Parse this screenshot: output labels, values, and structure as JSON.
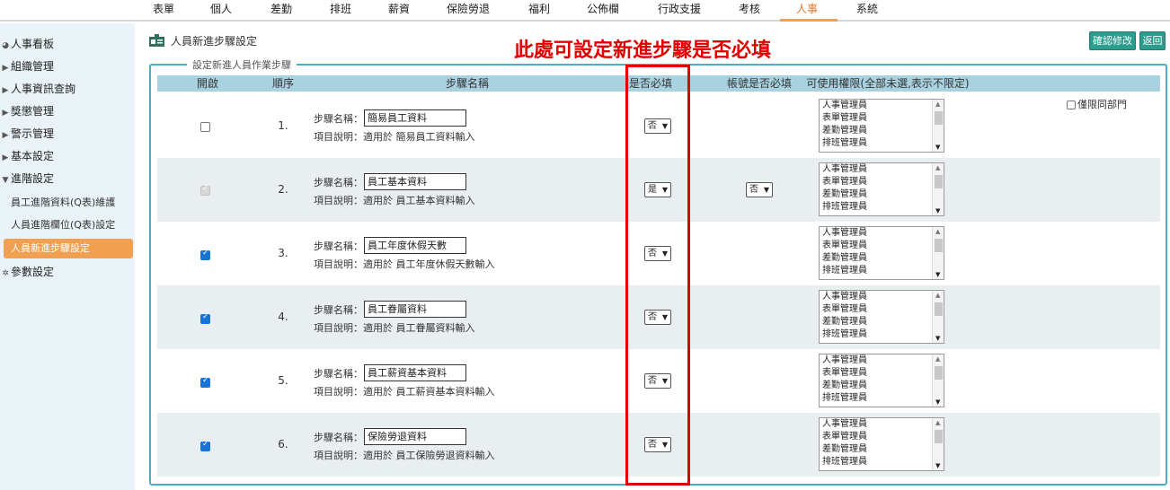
{
  "nav": {
    "items": [
      "表單",
      "個人",
      "差勤",
      "排班",
      "薪資",
      "保險勞退",
      "福利",
      "公佈欄",
      "行政支援",
      "考核",
      "人事",
      "系統"
    ],
    "active": "人事",
    "accent_color": "#f0a050"
  },
  "sidebar": {
    "items": [
      "人事看板",
      "組織管理",
      "人事資訊查詢",
      "獎懲管理",
      "警示管理",
      "基本設定",
      "進階設定",
      "參數設定"
    ],
    "sub_items": [
      "員工進階資料(Q表)維護",
      "人員進階欄位(Q表)設定",
      "人員新進步驟設定"
    ],
    "active_sub": "人員新進步驟設定"
  },
  "page": {
    "title": "人員新進步驟設定",
    "confirm_label": "確認修改",
    "back_label": "返回",
    "annotation": "此處可設定新進步驟是否必填",
    "legend": "設定新進人員作業步驟",
    "icons": [
      "id-card-icon"
    ]
  },
  "table": {
    "headers": {
      "enable": "開啟",
      "order": "順序",
      "name": "步驟名稱",
      "required": "是否必填",
      "account_required": "帳號是否必填",
      "permission": "可使用權限(全部未選,表示不限定)"
    },
    "name_label": "步驟名稱：",
    "roles": [
      "人事管理員",
      "表單管理員",
      "差勤管理員",
      "排班管理員"
    ],
    "same_dept_label": "僅限同部門",
    "rows": [
      {
        "order": "1.",
        "enabled": "unchecked",
        "name": "簡易員工資料",
        "desc": "項目說明：適用於 簡易員工資料輸入",
        "required": "否",
        "account_required": ""
      },
      {
        "order": "2.",
        "enabled": "disabled",
        "name": "員工基本資料",
        "desc": "項目說明：適用於 員工基本資料輸入",
        "required": "是",
        "account_required": "否"
      },
      {
        "order": "3.",
        "enabled": "checked",
        "name": "員工年度休假天數",
        "desc": "項目說明：適用於 員工年度休假天數輸入",
        "required": "否",
        "account_required": ""
      },
      {
        "order": "4.",
        "enabled": "checked",
        "name": "員工眷屬資料",
        "desc": "項目說明：適用於 員工眷屬資料輸入",
        "required": "否",
        "account_required": ""
      },
      {
        "order": "5.",
        "enabled": "checked",
        "name": "員工薪資基本資料",
        "desc": "項目說明：適用於 員工薪資基本資料輸入",
        "required": "否",
        "account_required": ""
      },
      {
        "order": "6.",
        "enabled": "checked",
        "name": "保險勞退資料",
        "desc": "項目說明：適用於 員工保險勞退資料輸入",
        "required": "否",
        "account_required": ""
      }
    ]
  },
  "colors": {
    "header_bg": "#a9d2e0",
    "fieldset_border": "#46b0c4",
    "button_bg": "#2a9d8f",
    "annotation": "#e00000"
  }
}
